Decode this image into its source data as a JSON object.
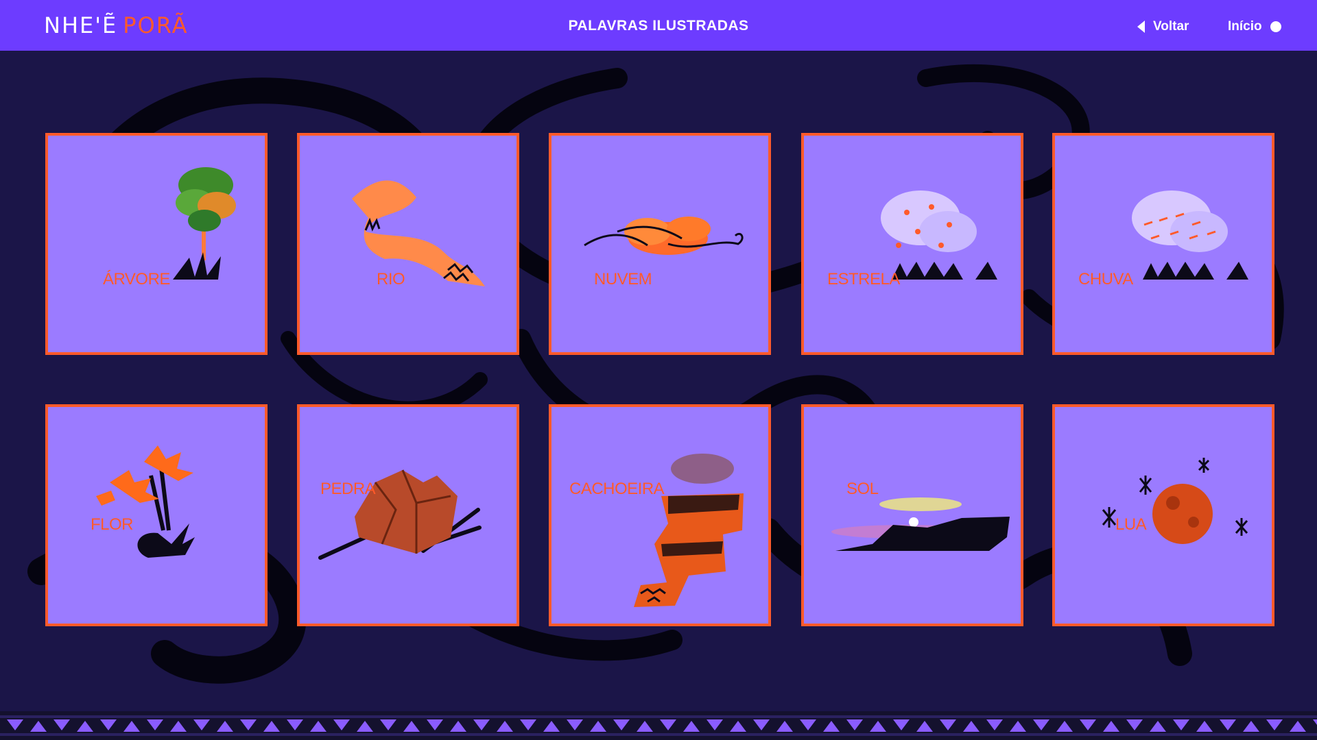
{
  "header": {
    "logo_part1": "NHE'Ẽ",
    "logo_part2": "PORÃ",
    "title": "PALAVRAS ILUSTRADAS",
    "back_label": "Voltar",
    "home_label": "Início"
  },
  "cards": [
    {
      "label": "ÁRVORE",
      "icon": "tree-icon"
    },
    {
      "label": "RIO",
      "icon": "river-icon"
    },
    {
      "label": "NUVEM",
      "icon": "cloud-icon"
    },
    {
      "label": "ESTRELA",
      "icon": "stars-cloud-icon"
    },
    {
      "label": "CHUVA",
      "icon": "rain-cloud-icon"
    },
    {
      "label": "FLOR",
      "icon": "flower-icon"
    },
    {
      "label": "PEDRA",
      "icon": "rock-icon"
    },
    {
      "label": "CACHOEIRA",
      "icon": "waterfall-icon"
    },
    {
      "label": "SOL",
      "icon": "sunset-icon"
    },
    {
      "label": "LUA",
      "icon": "moon-icon"
    }
  ],
  "colors": {
    "header_bg": "#6d3cff",
    "page_bg": "#1b1548",
    "card_bg": "#9b7bff",
    "accent": "#ff5a2a"
  }
}
